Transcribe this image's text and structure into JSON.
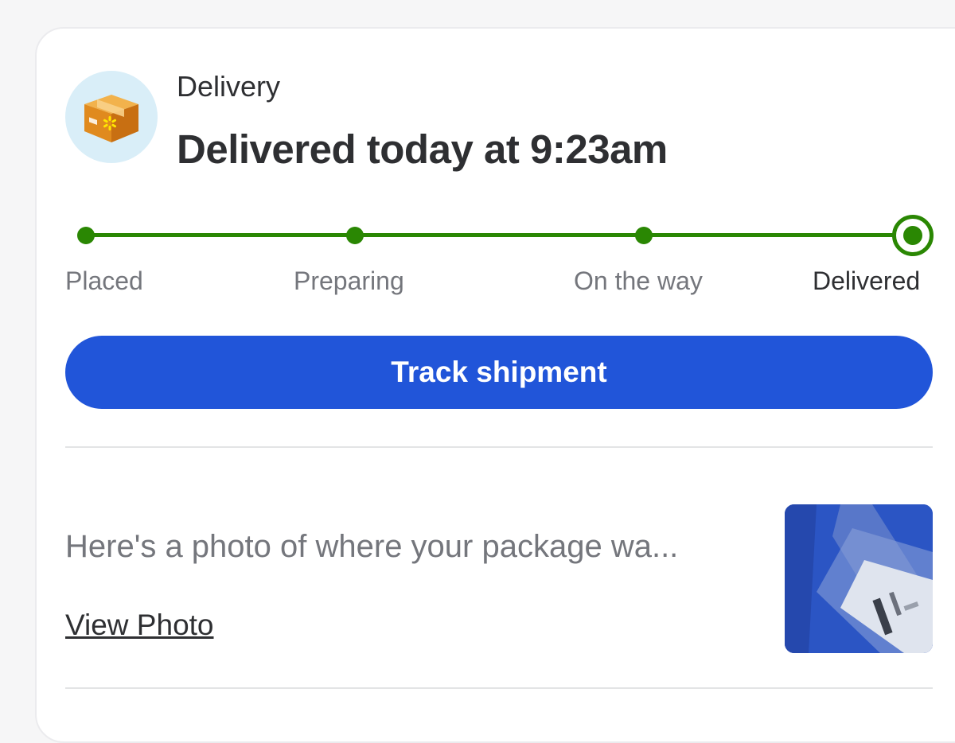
{
  "delivery": {
    "section_label": "Delivery",
    "status_title": "Delivered today at 9:23am",
    "icon": "package-box-icon"
  },
  "progress": {
    "steps": [
      {
        "label": "Placed",
        "state": "done"
      },
      {
        "label": "Preparing",
        "state": "done"
      },
      {
        "label": "On the way",
        "state": "done"
      },
      {
        "label": "Delivered",
        "state": "current"
      }
    ],
    "color": "#2a8703"
  },
  "actions": {
    "track_label": "Track shipment",
    "track_color": "#2155d9"
  },
  "photo": {
    "description": "Here's a photo of where your package wa...",
    "link_label": "View Photo"
  }
}
